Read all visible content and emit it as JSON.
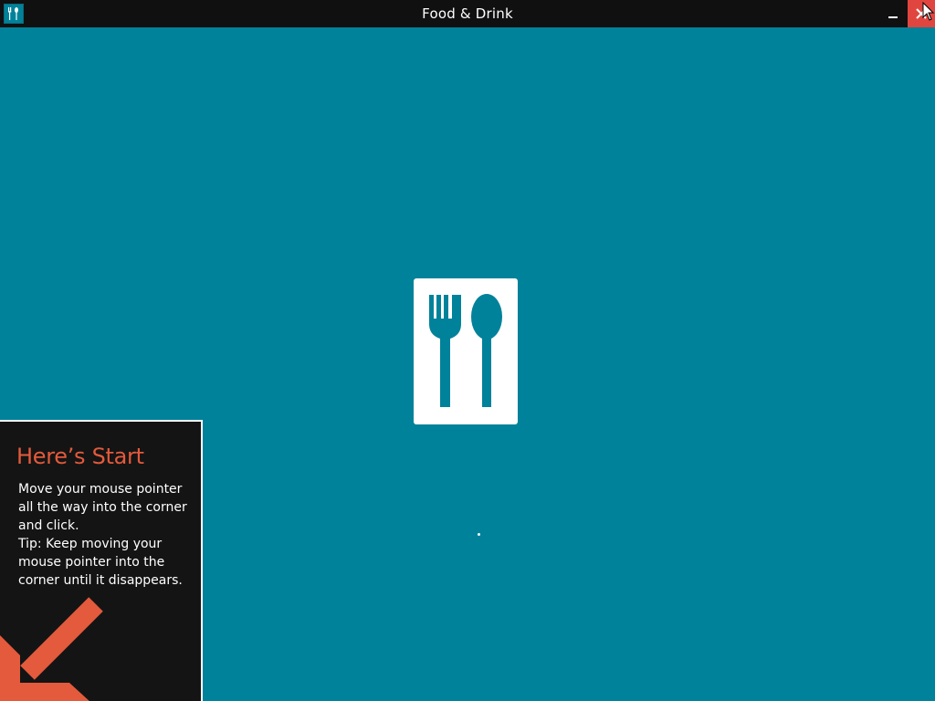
{
  "window": {
    "title": "Food & Drink",
    "background_color": "#00829a"
  },
  "titlebar": {
    "app_icon": "fork-knife-icon",
    "minimize_icon": "minimize-icon",
    "close_icon": "close-icon",
    "close_color": "#e0463f"
  },
  "splash": {
    "icon": "fork-and-spoon-icon",
    "tile_color": "#ffffff"
  },
  "callout": {
    "title": "Here’s Start",
    "lines": [
      "Move your mouse pointer",
      "all the way into the corner",
      "and click.",
      "Tip: Keep moving your",
      "mouse pointer into the",
      "corner until it disappears."
    ],
    "title_color": "#e35a3c",
    "arrow_icon": "arrow-down-left-icon",
    "arrow_color": "#e35a3c"
  }
}
